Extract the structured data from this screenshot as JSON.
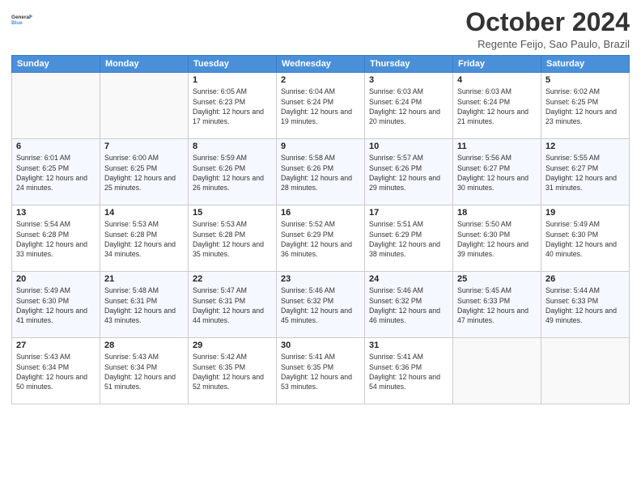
{
  "header": {
    "logo_line1": "General",
    "logo_line2": "Blue",
    "month_title": "October 2024",
    "location": "Regente Feijo, Sao Paulo, Brazil"
  },
  "weekdays": [
    "Sunday",
    "Monday",
    "Tuesday",
    "Wednesday",
    "Thursday",
    "Friday",
    "Saturday"
  ],
  "weeks": [
    [
      {
        "day": "",
        "info": ""
      },
      {
        "day": "",
        "info": ""
      },
      {
        "day": "1",
        "info": "Sunrise: 6:05 AM\nSunset: 6:23 PM\nDaylight: 12 hours and 17 minutes."
      },
      {
        "day": "2",
        "info": "Sunrise: 6:04 AM\nSunset: 6:24 PM\nDaylight: 12 hours and 19 minutes."
      },
      {
        "day": "3",
        "info": "Sunrise: 6:03 AM\nSunset: 6:24 PM\nDaylight: 12 hours and 20 minutes."
      },
      {
        "day": "4",
        "info": "Sunrise: 6:03 AM\nSunset: 6:24 PM\nDaylight: 12 hours and 21 minutes."
      },
      {
        "day": "5",
        "info": "Sunrise: 6:02 AM\nSunset: 6:25 PM\nDaylight: 12 hours and 23 minutes."
      }
    ],
    [
      {
        "day": "6",
        "info": "Sunrise: 6:01 AM\nSunset: 6:25 PM\nDaylight: 12 hours and 24 minutes."
      },
      {
        "day": "7",
        "info": "Sunrise: 6:00 AM\nSunset: 6:25 PM\nDaylight: 12 hours and 25 minutes."
      },
      {
        "day": "8",
        "info": "Sunrise: 5:59 AM\nSunset: 6:26 PM\nDaylight: 12 hours and 26 minutes."
      },
      {
        "day": "9",
        "info": "Sunrise: 5:58 AM\nSunset: 6:26 PM\nDaylight: 12 hours and 28 minutes."
      },
      {
        "day": "10",
        "info": "Sunrise: 5:57 AM\nSunset: 6:26 PM\nDaylight: 12 hours and 29 minutes."
      },
      {
        "day": "11",
        "info": "Sunrise: 5:56 AM\nSunset: 6:27 PM\nDaylight: 12 hours and 30 minutes."
      },
      {
        "day": "12",
        "info": "Sunrise: 5:55 AM\nSunset: 6:27 PM\nDaylight: 12 hours and 31 minutes."
      }
    ],
    [
      {
        "day": "13",
        "info": "Sunrise: 5:54 AM\nSunset: 6:28 PM\nDaylight: 12 hours and 33 minutes."
      },
      {
        "day": "14",
        "info": "Sunrise: 5:53 AM\nSunset: 6:28 PM\nDaylight: 12 hours and 34 minutes."
      },
      {
        "day": "15",
        "info": "Sunrise: 5:53 AM\nSunset: 6:28 PM\nDaylight: 12 hours and 35 minutes."
      },
      {
        "day": "16",
        "info": "Sunrise: 5:52 AM\nSunset: 6:29 PM\nDaylight: 12 hours and 36 minutes."
      },
      {
        "day": "17",
        "info": "Sunrise: 5:51 AM\nSunset: 6:29 PM\nDaylight: 12 hours and 38 minutes."
      },
      {
        "day": "18",
        "info": "Sunrise: 5:50 AM\nSunset: 6:30 PM\nDaylight: 12 hours and 39 minutes."
      },
      {
        "day": "19",
        "info": "Sunrise: 5:49 AM\nSunset: 6:30 PM\nDaylight: 12 hours and 40 minutes."
      }
    ],
    [
      {
        "day": "20",
        "info": "Sunrise: 5:49 AM\nSunset: 6:30 PM\nDaylight: 12 hours and 41 minutes."
      },
      {
        "day": "21",
        "info": "Sunrise: 5:48 AM\nSunset: 6:31 PM\nDaylight: 12 hours and 43 minutes."
      },
      {
        "day": "22",
        "info": "Sunrise: 5:47 AM\nSunset: 6:31 PM\nDaylight: 12 hours and 44 minutes."
      },
      {
        "day": "23",
        "info": "Sunrise: 5:46 AM\nSunset: 6:32 PM\nDaylight: 12 hours and 45 minutes."
      },
      {
        "day": "24",
        "info": "Sunrise: 5:46 AM\nSunset: 6:32 PM\nDaylight: 12 hours and 46 minutes."
      },
      {
        "day": "25",
        "info": "Sunrise: 5:45 AM\nSunset: 6:33 PM\nDaylight: 12 hours and 47 minutes."
      },
      {
        "day": "26",
        "info": "Sunrise: 5:44 AM\nSunset: 6:33 PM\nDaylight: 12 hours and 49 minutes."
      }
    ],
    [
      {
        "day": "27",
        "info": "Sunrise: 5:43 AM\nSunset: 6:34 PM\nDaylight: 12 hours and 50 minutes."
      },
      {
        "day": "28",
        "info": "Sunrise: 5:43 AM\nSunset: 6:34 PM\nDaylight: 12 hours and 51 minutes."
      },
      {
        "day": "29",
        "info": "Sunrise: 5:42 AM\nSunset: 6:35 PM\nDaylight: 12 hours and 52 minutes."
      },
      {
        "day": "30",
        "info": "Sunrise: 5:41 AM\nSunset: 6:35 PM\nDaylight: 12 hours and 53 minutes."
      },
      {
        "day": "31",
        "info": "Sunrise: 5:41 AM\nSunset: 6:36 PM\nDaylight: 12 hours and 54 minutes."
      },
      {
        "day": "",
        "info": ""
      },
      {
        "day": "",
        "info": ""
      }
    ]
  ]
}
